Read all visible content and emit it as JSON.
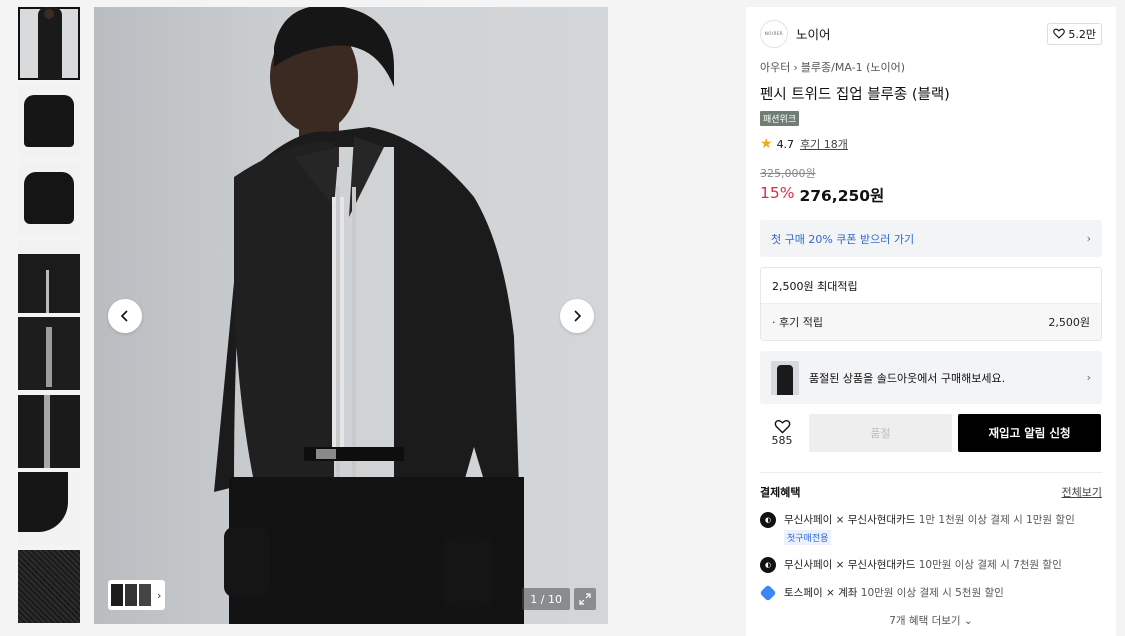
{
  "thumbnails": [
    "thumb-1",
    "thumb-2",
    "thumb-3",
    "thumb-4",
    "thumb-5",
    "thumb-6",
    "thumb-7",
    "thumb-8"
  ],
  "viewer": {
    "counter": "1 / 10"
  },
  "brand": {
    "logo_text": "NOIRER",
    "name": "노이어",
    "likes": "5.2만"
  },
  "breadcrumb": {
    "level1": "아우터",
    "level2": "블루종/MA-1 (노이어)"
  },
  "product": {
    "title": "펜시 트위드 집업 블루종 (블랙)",
    "badge": "패션위크",
    "rating": "4.7",
    "reviews": "후기 18개",
    "original_price": "325,000원",
    "discount": "15%",
    "price": "276,250원"
  },
  "coupon": {
    "label": "첫 구매 20% 쿠폰 받으러 가기"
  },
  "points": {
    "header": "2,500원 최대적립",
    "row_label": "· 후기 적립",
    "row_value": "2,500원"
  },
  "soldout": {
    "label": "품절된 상품을 솔드아웃에서 구매해보세요."
  },
  "actions": {
    "like_count": "585",
    "soldout_label": "품절",
    "restock_label": "재입고 알림 신청"
  },
  "benefits": {
    "title": "결제혜택",
    "view_all": "전체보기",
    "items": [
      {
        "main": "무신사페이 × 무신사현대카드",
        "detail": "1만 1천원 이상 결제 시 1만원 할인",
        "tag": "첫구매전용"
      },
      {
        "main": "무신사페이 × 무신사현대카드",
        "detail": "10만원 이상 결제 시 7천원 할인",
        "tag": ""
      },
      {
        "main": "토스페이 × 계좌",
        "detail": "10만원 이상 결제 시 5천원 할인",
        "tag": ""
      }
    ],
    "more": "7개 혜택 더보기"
  },
  "colors": {
    "accent_red": "#e32b3f",
    "link_blue": "#2f68d3",
    "badge_green": "#6f7d73"
  }
}
